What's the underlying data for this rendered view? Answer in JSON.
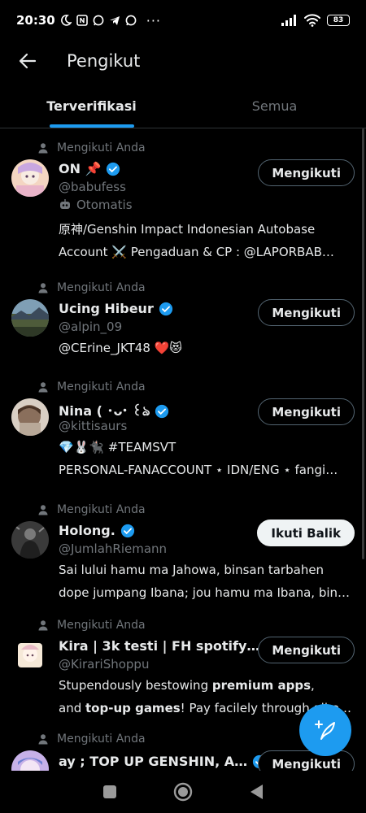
{
  "status_bar": {
    "time": "20:30",
    "battery": "83",
    "icons": [
      "moon-icon",
      "nfc-icon",
      "whatsapp-icon",
      "telegram-icon",
      "whatsapp-icon",
      "more-dots"
    ]
  },
  "header": {
    "title": "Pengikut"
  },
  "tabs": [
    {
      "label": "Terverifikasi",
      "active": true
    },
    {
      "label": "Semua",
      "active": false
    }
  ],
  "follows_you_label": "Mengikuti Anda",
  "followers": [
    {
      "name": "ON 📌",
      "handle": "@babufess",
      "bot_label": "Otomatis",
      "bio_lines": [
        "原神/Genshin Impact Indonesian Autobase",
        "Account ⚔️ Pengaduan & CP : @LAPORBAB…"
      ],
      "button": "Mengikuti",
      "avatar_colors": [
        "#f4d6c2",
        "#c9a7e0"
      ]
    },
    {
      "name": "Ucing Hibeur",
      "handle": "@alpin_09",
      "bio_lines": [
        "@CErine_JKT48 ❤️😻"
      ],
      "button": "Mengikuti",
      "avatar_colors": [
        "#5d7c8f",
        "#3a4a2e"
      ]
    },
    {
      "name": "Nina ( ･ᴗ･ ꒰ঌ",
      "handle": "@kittisaurs",
      "bio_lines": [
        "💎🐰🐈‍⬛ #TEAMSVT",
        "PERSONAL-FANACCOUNT ⋆ IDN/ENG ⋆ fangi…"
      ],
      "button": "Mengikuti",
      "avatar_colors": [
        "#8a6f5c",
        "#d9cfc4"
      ]
    },
    {
      "name": "Holong.",
      "handle": "@JumlahRiemann",
      "bio_lines": [
        "Sai lului hamu ma Jahowa, binsan tarbahen",
        "dope jumpang Ibana; jou hamu ma Ibana, bin…"
      ],
      "button": "Ikuti Balik",
      "avatar_colors": [
        "#2b2b2b",
        "#6b6b6b"
      ]
    },
    {
      "name": "Kira | 3k testi | FH spotify…",
      "handle": "@KirariShoppu",
      "bio_parts": [
        [
          {
            "t": "Stupendously bestowing ",
            "b": false
          },
          {
            "t": "premium apps",
            "b": true
          },
          {
            "t": ",",
            "b": false
          }
        ],
        [
          {
            "t": "and ",
            "b": false
          },
          {
            "t": "top-up games",
            "b": true
          },
          {
            "t": "! Pay facilely through all e-…",
            "b": false
          }
        ]
      ],
      "button": "Mengikuti",
      "avatar_colors": [
        "#f6e9d8",
        "#e8b9c4"
      ]
    },
    {
      "name": "ay ; TOP UP GENSHIN, A…",
      "handle": "",
      "bio_lines": [],
      "button": "Mengikuti",
      "avatar_colors": [
        "#6d7fd1",
        "#c7b1e8"
      ]
    }
  ],
  "colors": {
    "accent": "#1d9bf0",
    "text_primary": "#e7e9ea",
    "text_secondary": "#71767b",
    "background": "#000000"
  }
}
